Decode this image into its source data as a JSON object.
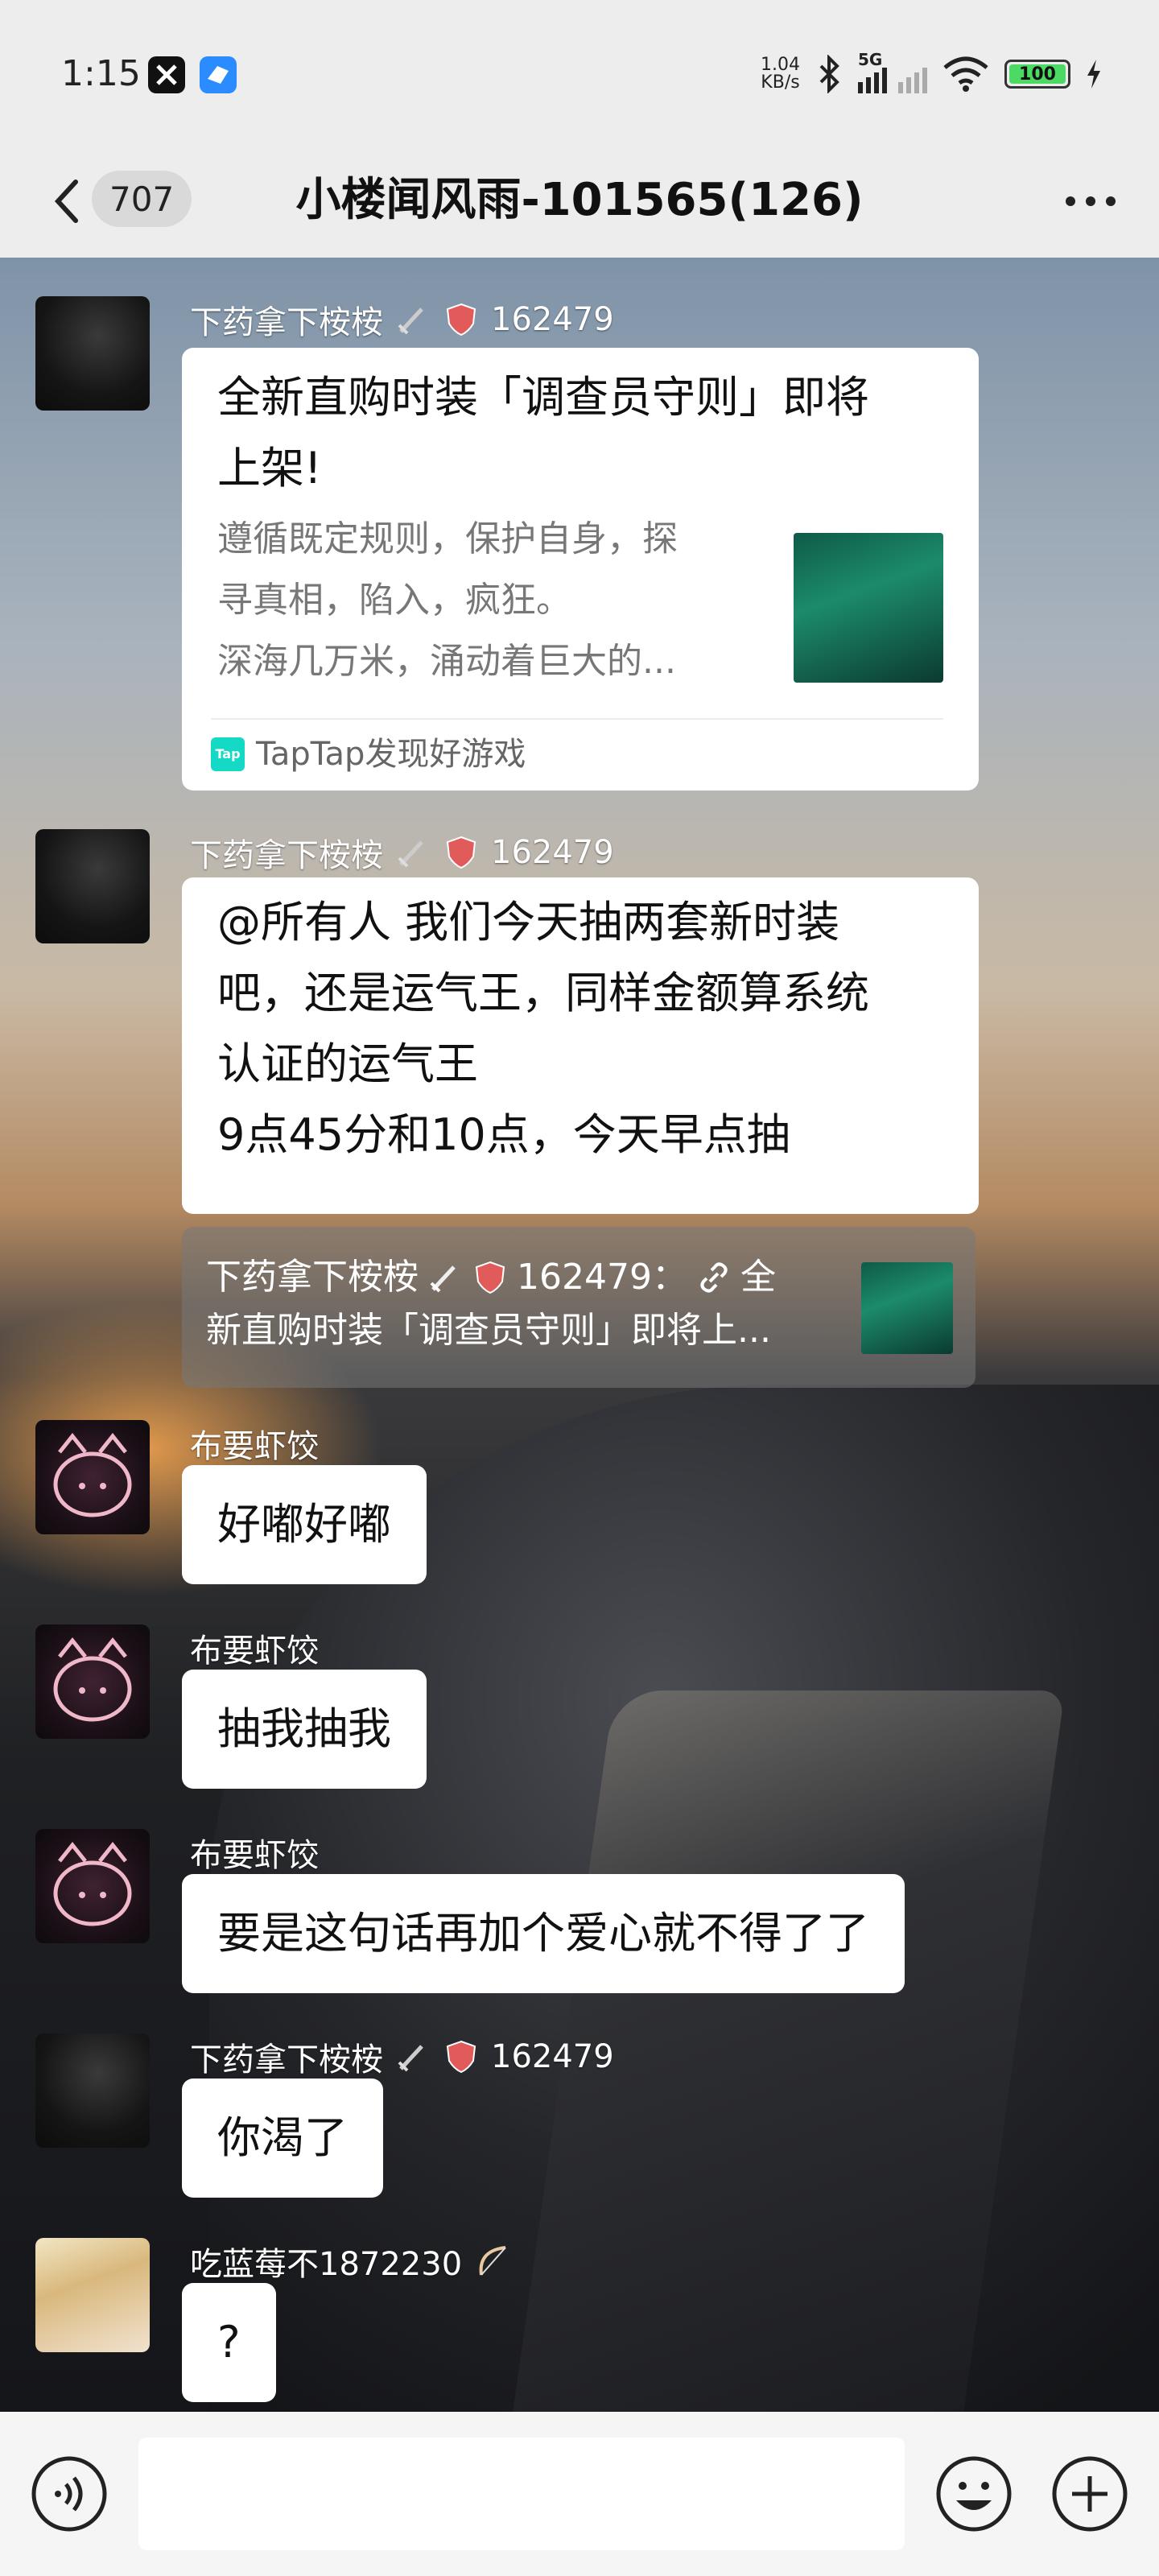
{
  "status_bar": {
    "time": "1:15",
    "net_speed_value": "1.04",
    "net_speed_unit": "KB/s",
    "network": "5G",
    "battery": "100"
  },
  "header": {
    "unread_count": "707",
    "title": "小楼闻风雨-101565(126)"
  },
  "messages": [
    {
      "sender": "下药拿下桉桉",
      "sender_id": "162479",
      "card": {
        "title": "全新直购时装「调查员守则」即将上架!",
        "title_line1": "全新直购时装「调查员守则」即将",
        "title_line2": "上架!",
        "desc_line1": "遵循既定规则，保护自身，探",
        "desc_line2": "寻真相，陷入，疯狂。",
        "desc_line3": "深海几万米，涌动着巨大的...",
        "source": "TapTap发现好游戏",
        "source_logo": "Tap"
      }
    },
    {
      "sender": "下药拿下桉桉",
      "sender_id": "162479",
      "lines": [
        "@所有人  我们今天抽两套新时装",
        "吧，还是运气王，同样金额算系统",
        "认证的运气王",
        "9点45分和10点，今天早点抽"
      ],
      "quote_line1": "下药拿下桉桉",
      "quote_id": "162479：",
      "quote_line1_tail": "全",
      "quote_line2": "新直购时装「调查员守则」即将上..."
    },
    {
      "sender": "布要虾饺",
      "text": "好嘟好嘟"
    },
    {
      "sender": "布要虾饺",
      "text": "抽我抽我"
    },
    {
      "sender": "布要虾饺",
      "text": "要是这句话再加个爱心就不得了了"
    },
    {
      "sender": "下药拿下桉桉",
      "sender_id": "162479",
      "text": "你渴了"
    },
    {
      "sender": "吃蓝莓不1872230",
      "text": "?"
    }
  ],
  "input": {
    "placeholder": ""
  },
  "colors": {
    "bubble": "#ffffff",
    "battery": "#4cd964",
    "taptap": "#14d9c5"
  }
}
